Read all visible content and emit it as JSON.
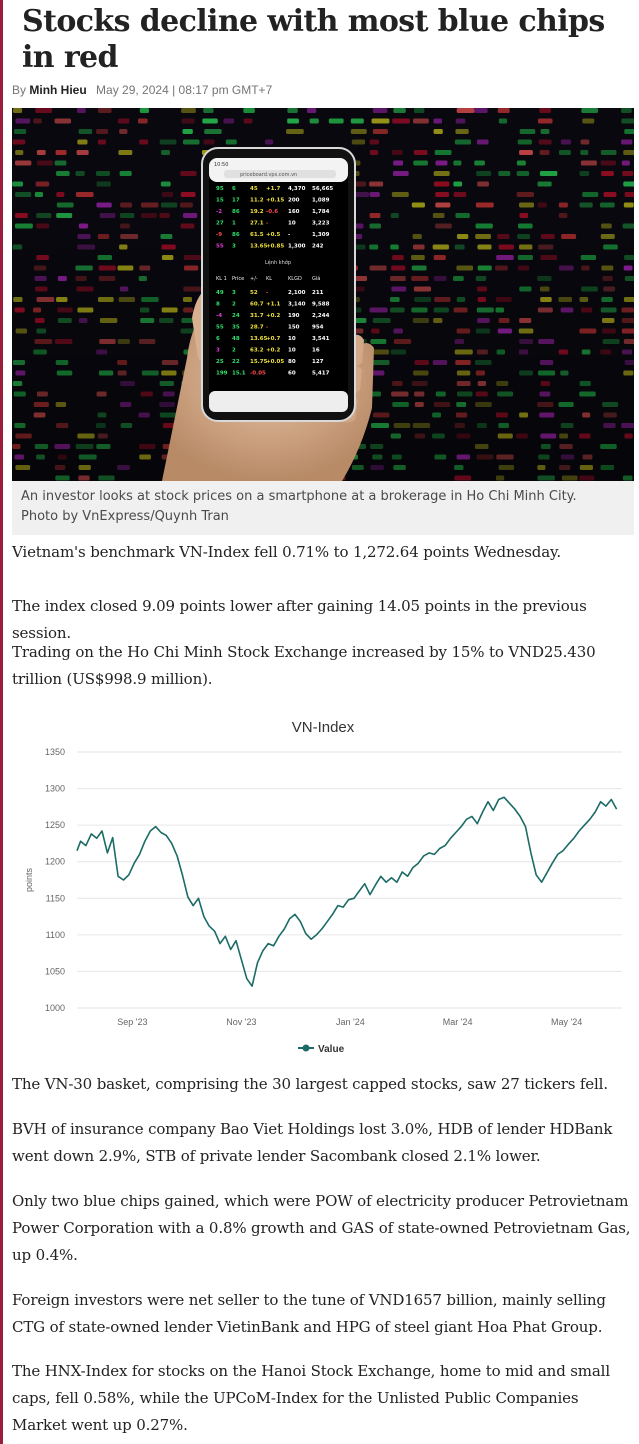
{
  "article": {
    "title": "Stocks decline with most blue chips in red",
    "byline_prefix": "By",
    "author": "Minh Hieu",
    "date": "May 29, 2024 | 08:17 pm GMT+7"
  },
  "hero": {
    "caption_line1": "An investor looks at stock prices on a smartphone at a brokerage in Ho Chi Minh City.",
    "caption_line2": "Photo by VnExpress/Quynh Tran",
    "phone_time": "10:50",
    "phone_url": "priceboard.vps.com.vn",
    "phone_section": "Lệnh khớp",
    "phone_header": [
      "KL 1",
      "Price",
      "+/-",
      "KL",
      "KLGD",
      "Giá"
    ],
    "phone_rows": [
      [
        "95",
        "6",
        "45",
        "+1.7",
        "4,370",
        "56,665"
      ],
      [
        "15",
        "17",
        "11.2",
        "+0.15",
        "200",
        "1,089"
      ],
      [
        "-2",
        "86",
        "19.2",
        "-0.6",
        "160",
        "1,784"
      ],
      [
        "27",
        "1",
        "27.1",
        "-",
        "10",
        "3,223"
      ],
      [
        "-9",
        "86",
        "61.5",
        "+0.5",
        "-",
        "1,309"
      ],
      [
        "55",
        "3",
        "13.65",
        "+0.85",
        "1,300",
        "242"
      ],
      [
        "49",
        "3",
        "52",
        "-",
        "2,100",
        "211"
      ],
      [
        "8",
        "2",
        "60.7",
        "+1.1",
        "3,140",
        "9,588"
      ],
      [
        "-4",
        "24",
        "31.7",
        "+0.2",
        "190",
        "2,244"
      ],
      [
        "55",
        "35",
        "28.7",
        "-",
        "150",
        "954"
      ],
      [
        "6",
        "48",
        "13.65",
        "+0.7",
        "10",
        "3,541"
      ],
      [
        "3",
        "2",
        "63.2",
        "+0.2",
        "10",
        "16"
      ],
      [
        "25",
        "22",
        "15.75",
        "+0.05",
        "80",
        "127"
      ],
      [
        "199",
        "15.1",
        "-0.05",
        "",
        "60",
        "5,417"
      ]
    ]
  },
  "paragraphs": {
    "p1": "Vietnam's benchmark VN-Index fell 0.71% to 1,272.64 points Wednesday.",
    "p2": "The index closed 9.09 points lower after gaining 14.05 points in the previous session.",
    "p3": "Trading on the Ho Chi Minh Stock Exchange increased by 15% to VND25.430 trillion (US$998.9 million).",
    "p4": "The VN-30 basket, comprising the 30 largest capped stocks, saw 27 tickers fell.",
    "p5": "BVH of insurance company Bao Viet Holdings lost 3.0%, HDB of lender HDBank went down 2.9%, STB of private lender Sacombank closed 2.1% lower.",
    "p6": "Only two blue chips gained, which were POW of electricity producer Petrovietnam Power Corporation with a 0.8% growth and GAS of state-owned Petrovietnam Gas, up 0.4%.",
    "p7": "Foreign investors were net seller to the tune of VND1657 billion, mainly selling CTG of state-owned lender VietinBank and HPG of steel giant Hoa Phat Group.",
    "p8": "The HNX-Index for stocks on the Hanoi Stock Exchange, home to mid and small caps, fell 0.58%, while the UPCoM-Index for the Unlisted Public Companies Market went up 0.27%."
  },
  "colors": {
    "accent_rule": "#9a1d3c",
    "series": "#1b6b66",
    "grid": "#e6e6e6",
    "caption_bg": "#f0f0f0"
  },
  "chart_data": {
    "type": "line",
    "title": "VN-Index",
    "ylabel": "points",
    "xlabel": "",
    "ylim": [
      1000,
      1350
    ],
    "yticks": [
      1000,
      1050,
      1100,
      1150,
      1200,
      1250,
      1300,
      1350
    ],
    "xlim": [
      "2023-08-01",
      "2024-06-01"
    ],
    "xticks": [
      {
        "date": "2023-09-01",
        "label": "Sep '23"
      },
      {
        "date": "2023-11-01",
        "label": "Nov '23"
      },
      {
        "date": "2024-01-01",
        "label": "Jan '24"
      },
      {
        "date": "2024-03-01",
        "label": "Mar '24"
      },
      {
        "date": "2024-05-01",
        "label": "May '24"
      }
    ],
    "grid": true,
    "legend_position": "bottom",
    "series": [
      {
        "name": "Value",
        "x": [
          "2023-08-01",
          "2023-08-03",
          "2023-08-06",
          "2023-08-09",
          "2023-08-12",
          "2023-08-15",
          "2023-08-18",
          "2023-08-21",
          "2023-08-24",
          "2023-08-27",
          "2023-08-30",
          "2023-09-02",
          "2023-09-05",
          "2023-09-08",
          "2023-09-11",
          "2023-09-14",
          "2023-09-17",
          "2023-09-20",
          "2023-09-23",
          "2023-09-26",
          "2023-09-29",
          "2023-10-02",
          "2023-10-05",
          "2023-10-08",
          "2023-10-11",
          "2023-10-14",
          "2023-10-17",
          "2023-10-20",
          "2023-10-23",
          "2023-10-26",
          "2023-10-29",
          "2023-11-01",
          "2023-11-04",
          "2023-11-07",
          "2023-11-10",
          "2023-11-13",
          "2023-11-16",
          "2023-11-19",
          "2023-11-22",
          "2023-11-25",
          "2023-11-28",
          "2023-12-01",
          "2023-12-04",
          "2023-12-07",
          "2023-12-10",
          "2023-12-13",
          "2023-12-16",
          "2023-12-19",
          "2023-12-22",
          "2023-12-25",
          "2023-12-28",
          "2023-12-31",
          "2024-01-03",
          "2024-01-06",
          "2024-01-09",
          "2024-01-12",
          "2024-01-15",
          "2024-01-18",
          "2024-01-21",
          "2024-01-24",
          "2024-01-27",
          "2024-01-30",
          "2024-02-02",
          "2024-02-05",
          "2024-02-08",
          "2024-02-11",
          "2024-02-14",
          "2024-02-17",
          "2024-02-20",
          "2024-02-23",
          "2024-02-26",
          "2024-02-29",
          "2024-03-03",
          "2024-03-06",
          "2024-03-09",
          "2024-03-12",
          "2024-03-15",
          "2024-03-18",
          "2024-03-21",
          "2024-03-24",
          "2024-03-27",
          "2024-03-30",
          "2024-04-02",
          "2024-04-05",
          "2024-04-08",
          "2024-04-11",
          "2024-04-14",
          "2024-04-17",
          "2024-04-20",
          "2024-04-23",
          "2024-04-26",
          "2024-04-29",
          "2024-05-02",
          "2024-05-05",
          "2024-05-08",
          "2024-05-11",
          "2024-05-14",
          "2024-05-17",
          "2024-05-20",
          "2024-05-23",
          "2024-05-26",
          "2024-05-29"
        ],
        "values": [
          1215,
          1228,
          1222,
          1238,
          1232,
          1242,
          1212,
          1233,
          1180,
          1175,
          1182,
          1198,
          1210,
          1228,
          1242,
          1248,
          1240,
          1236,
          1225,
          1208,
          1182,
          1152,
          1140,
          1150,
          1125,
          1112,
          1105,
          1088,
          1098,
          1080,
          1092,
          1066,
          1040,
          1030,
          1062,
          1078,
          1088,
          1085,
          1098,
          1108,
          1122,
          1128,
          1118,
          1102,
          1094,
          1100,
          1108,
          1118,
          1128,
          1140,
          1138,
          1148,
          1150,
          1160,
          1170,
          1155,
          1168,
          1180,
          1172,
          1178,
          1172,
          1186,
          1180,
          1192,
          1198,
          1208,
          1212,
          1210,
          1218,
          1222,
          1232,
          1240,
          1248,
          1258,
          1262,
          1252,
          1268,
          1282,
          1270,
          1285,
          1288,
          1280,
          1272,
          1262,
          1248,
          1212,
          1182,
          1172,
          1185,
          1198,
          1210,
          1215,
          1224,
          1232,
          1242,
          1250,
          1258,
          1268,
          1282,
          1276,
          1285,
          1272
        ]
      }
    ]
  }
}
